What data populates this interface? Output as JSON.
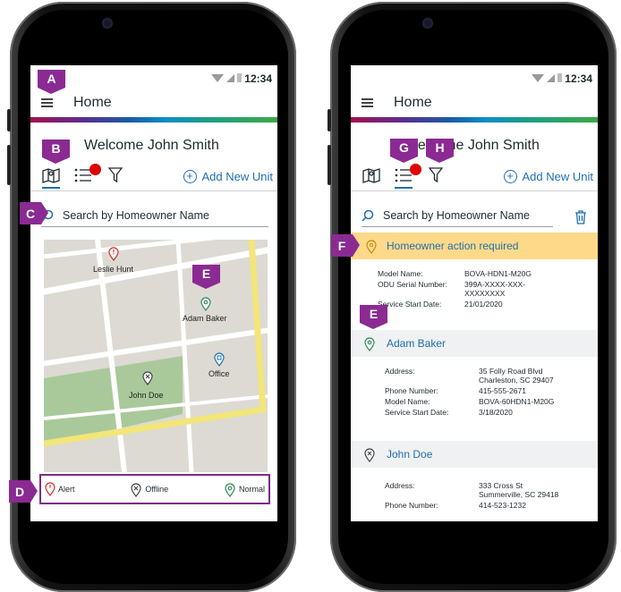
{
  "left": {
    "status_time": "12:34",
    "title": "Home",
    "welcome": "Welcome John Smith",
    "add_new": "Add New Unit",
    "search_placeholder": "Search by Homeowner Name",
    "map_pins": [
      {
        "label": "Leslie Hunt",
        "status": "alert"
      },
      {
        "label": "Adam Baker",
        "status": "normal"
      },
      {
        "label": "Office",
        "status": "office"
      },
      {
        "label": "John Doe",
        "status": "offline"
      }
    ],
    "legend": {
      "alert": "Alert",
      "offline": "Offline",
      "normal": "Normal"
    },
    "badges": {
      "a": "A",
      "b": "B",
      "c": "C",
      "d": "D",
      "e": "E"
    }
  },
  "right": {
    "status_time": "12:34",
    "title": "Home",
    "welcome": "Welcome John Smith",
    "add_new": "Add New Unit",
    "search_placeholder": "Search by Homeowner Name",
    "alert_text": "Homeowner action required",
    "alert_details": {
      "model_name_label": "Model Name:",
      "model_name": "BOVA-HDN1-M20G",
      "odu_label": "ODU Serial Number:",
      "odu_value": "399A-XXXX-XXX-XXXXXXXX",
      "service_label": "Service Start Date:",
      "service_value": "21/01/2020"
    },
    "adam": {
      "name": "Adam Baker",
      "address_label": "Address:",
      "address": "35 Folly Road Blvd Charleston, SC 29407",
      "phone_label": "Phone Number:",
      "phone": "415-555-2671",
      "model_label": "Model Name:",
      "model": "BOVA-60HDN1-M20G",
      "service_label": "Service Start Date:",
      "service": "3/18/2020"
    },
    "john": {
      "name": "John Doe",
      "address_label": "Address:",
      "address": "333 Cross St Summerville, SC 29418",
      "phone_label": "Phone Number:",
      "phone": "414-523-1232"
    },
    "badges": {
      "e": "E",
      "f": "F",
      "g": "G",
      "h": "H"
    }
  },
  "colors": {
    "accent": "#1f6fb0",
    "badge": "#8b2a93",
    "alert_bg": "#ffd98a",
    "red_dot": "#e00000"
  }
}
